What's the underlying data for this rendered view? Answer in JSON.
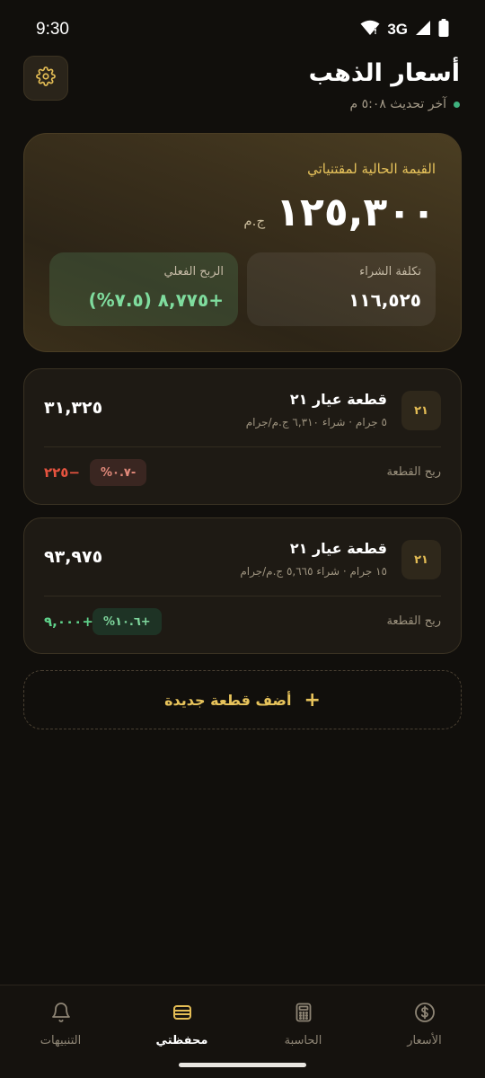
{
  "status_bar": {
    "time": "9:30",
    "network": "3G"
  },
  "header": {
    "title": "أسعار الذهب",
    "last_update": "آخر تحديث ٥:٠٨ م"
  },
  "portfolio": {
    "label": "القيمة الحالية لمقتنياتي",
    "total_value": "١٢٥,٣٠٠",
    "currency": "ج.م",
    "cost": {
      "label": "تكلفة الشراء",
      "value": "١١٦,٥٢٥"
    },
    "profit": {
      "label": "الربح الفعلي",
      "value": "+٨,٧٧٥ (٧.٥%)"
    }
  },
  "holdings": [
    {
      "karat": "٢١",
      "name": "قطعة عيار ٢١",
      "detail": "٥ جرام · شراء ٦,٣١٠ ج.م/جرام",
      "value": "٣١,٣٢٥",
      "profit_label": "ربح القطعة",
      "percent": "-٠.٧%",
      "profit": "−٢٢٥"
    },
    {
      "karat": "٢١",
      "name": "قطعة عيار ٢١",
      "detail": "١٥ جرام · شراء ٥,٦٦٥ ج.م/جرام",
      "value": "٩٣,٩٧٥",
      "profit_label": "ربح القطعة",
      "percent": "+١٠.٦%",
      "profit": "+٩,٠٠٠"
    }
  ],
  "add_button": {
    "label": "أضف قطعة جديدة",
    "icon": "+"
  },
  "nav": {
    "items": [
      {
        "label": "الأسعار",
        "icon": "dollar-icon"
      },
      {
        "label": "الحاسبة",
        "icon": "calculator-icon"
      },
      {
        "label": "محفظتي",
        "icon": "wallet-icon",
        "active": true
      },
      {
        "label": "التنبيهات",
        "icon": "bell-icon"
      }
    ]
  },
  "colors": {
    "accent_gold": "#e7c35b",
    "positive": "#5fd18a",
    "negative": "#e5533f",
    "background": "#110f0c"
  }
}
